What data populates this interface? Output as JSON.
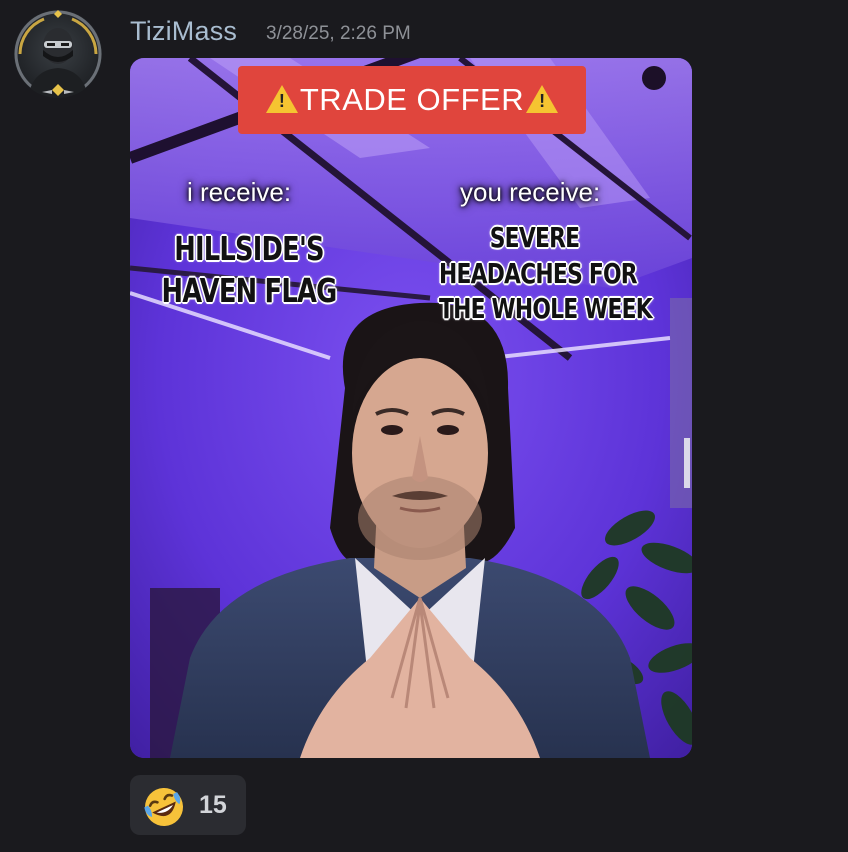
{
  "message": {
    "author": "TiziMass",
    "timestamp": "3/28/25, 2:26 PM"
  },
  "attachment": {
    "banner": "TRADE OFFER",
    "left_label": "i receive:",
    "right_label": "you receive:",
    "left_text_line1": "HILLSIDE'S",
    "left_text_line2": "HAVEN FLAG",
    "right_text_line1": "SEVERE",
    "right_text_line2": "HEADACHES FOR",
    "right_text_line3": "THE WHOLE WEEK"
  },
  "reaction": {
    "emoji": "rolling-on-the-floor-laughing",
    "count": "15"
  },
  "icons": {
    "avatar": "masked-ninja-avatar-icon",
    "warning": "warning-icon"
  }
}
